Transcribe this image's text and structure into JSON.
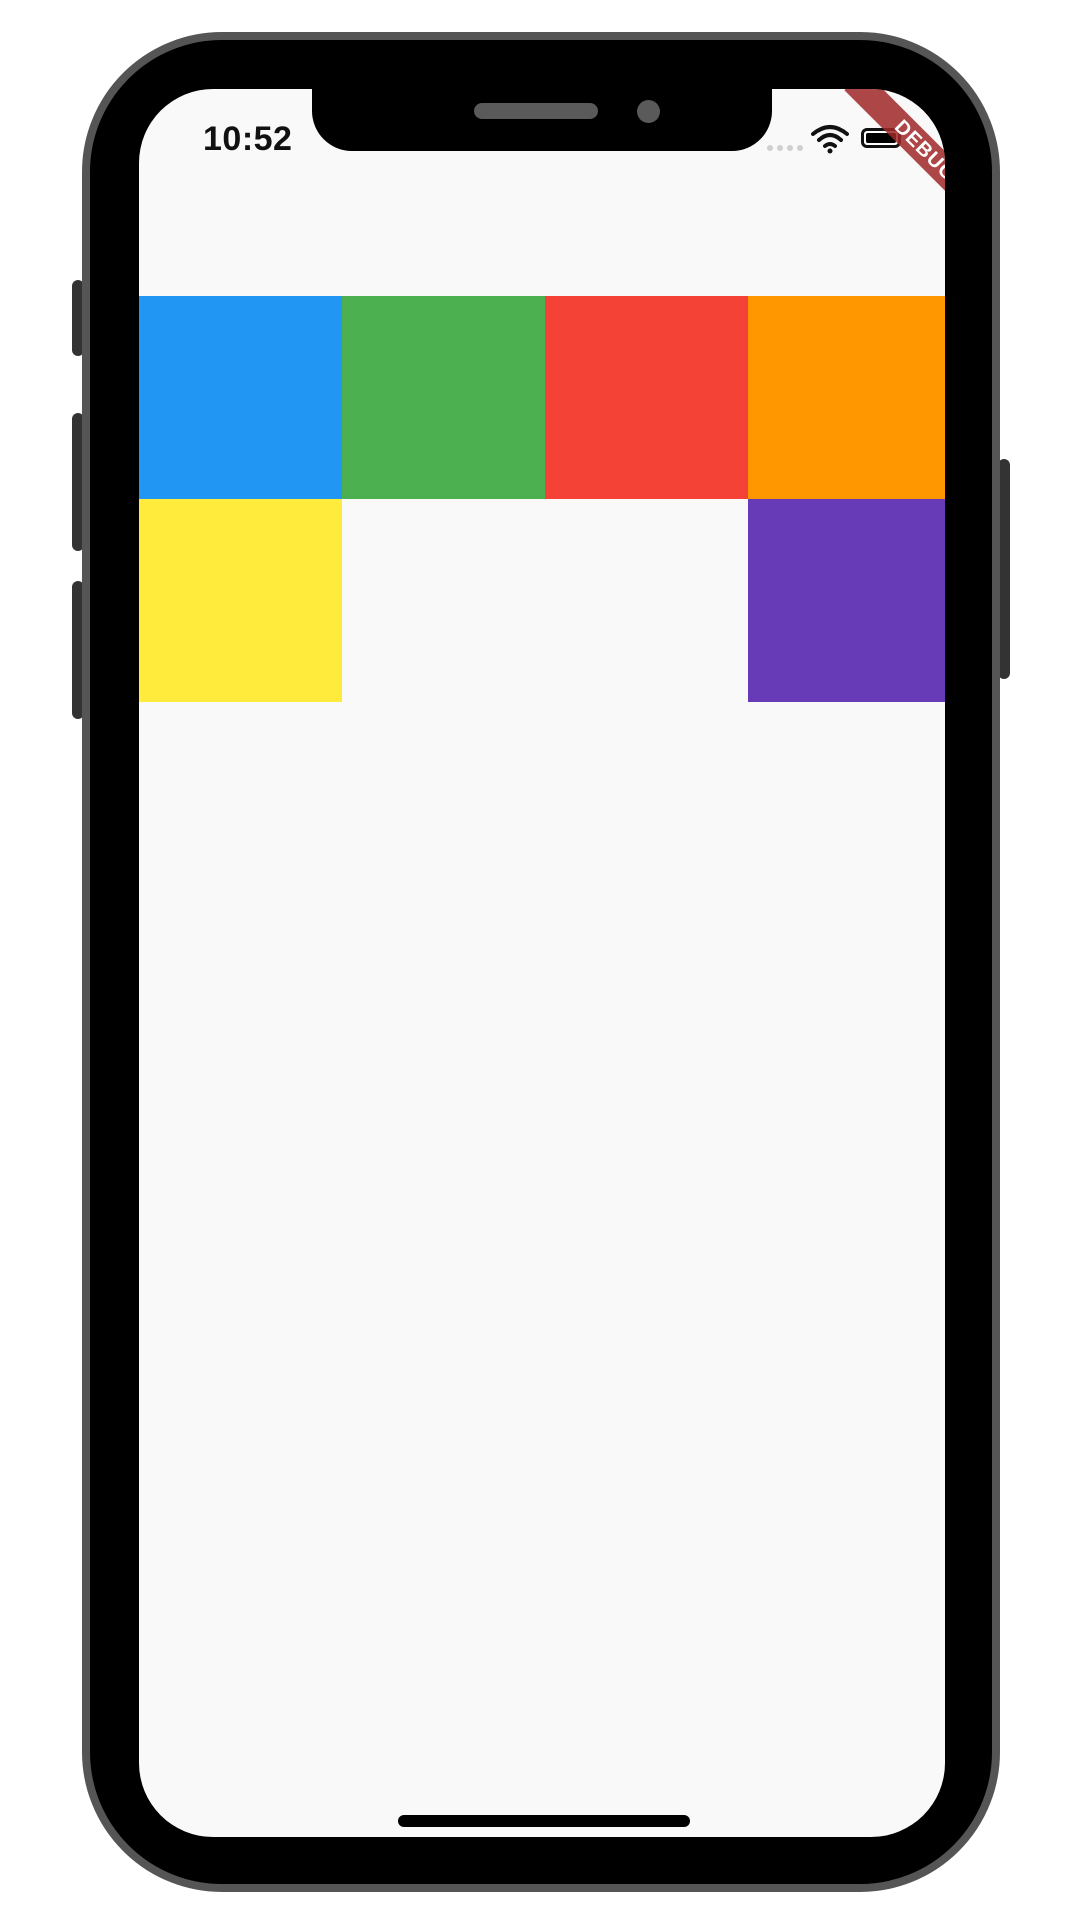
{
  "status_bar": {
    "time": "10:52",
    "debug_banner": "DEBUG"
  },
  "tiles": [
    {
      "name": "blue-tile",
      "color": "#2196F3"
    },
    {
      "name": "green-tile",
      "color": "#4CAF50"
    },
    {
      "name": "red-tile",
      "color": "#F44336"
    },
    {
      "name": "orange-tile",
      "color": "#FF9800"
    },
    {
      "name": "yellow-tile",
      "color": "#FFEB3B"
    },
    {
      "name": "purple-tile",
      "color": "#673AB7"
    }
  ],
  "colors": {
    "screen_background": "#F9F9F9",
    "debug_ribbon": "#A02828"
  },
  "icons": {
    "wifi": "wifi-icon",
    "battery": "battery-icon",
    "signal": "signal-dots-icon"
  }
}
